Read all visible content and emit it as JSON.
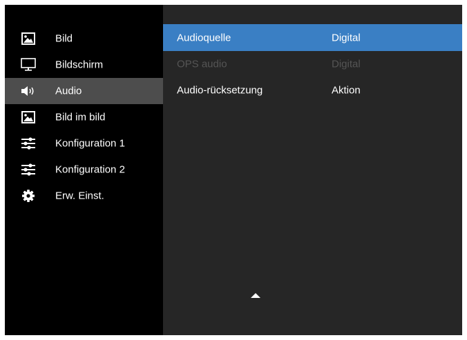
{
  "sidebar": {
    "items": [
      {
        "label": "Bild",
        "icon": "picture-icon",
        "active": false
      },
      {
        "label": "Bildschirm",
        "icon": "monitor-icon",
        "active": false
      },
      {
        "label": "Audio",
        "icon": "speaker-icon",
        "active": true
      },
      {
        "label": "Bild im bild",
        "icon": "picture-icon",
        "active": false
      },
      {
        "label": "Konfiguration 1",
        "icon": "sliders-icon",
        "active": false
      },
      {
        "label": "Konfiguration 2",
        "icon": "sliders-icon",
        "active": false
      },
      {
        "label": "Erw. Einst.",
        "icon": "gear-icon",
        "active": false
      }
    ]
  },
  "panel": {
    "rows": [
      {
        "name": "Audioquelle",
        "value": "Digital",
        "state": "selected"
      },
      {
        "name": "OPS audio",
        "value": "Digital",
        "state": "disabled"
      },
      {
        "name": "Audio-rücksetzung",
        "value": "Aktion",
        "state": "normal"
      }
    ],
    "scroll_indicator": "up-arrow-icon"
  },
  "colors": {
    "background": "#000000",
    "panel": "#262626",
    "active_item": "#4d4d4d",
    "selection": "#3a7fc4",
    "text": "#ffffff",
    "disabled_text": "#555555"
  }
}
